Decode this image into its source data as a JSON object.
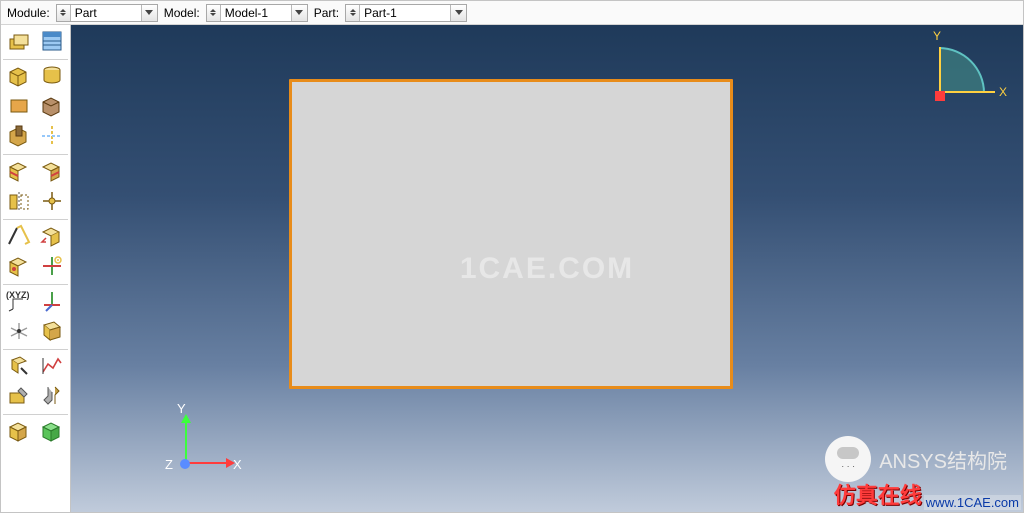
{
  "context": {
    "module_label": "Module:",
    "module_value": "Part",
    "model_label": "Model:",
    "model_value": "Model-1",
    "part_label": "Part:",
    "part_value": "Part-1"
  },
  "toolbox": {
    "row0": [
      "create-part",
      "part-manager"
    ],
    "row1": [
      "create-solid-extrude",
      "create-solid-revolve"
    ],
    "row2": [
      "create-shell",
      "create-wire"
    ],
    "row3": [
      "create-cut",
      "create-round"
    ],
    "row4": [
      "partition-cell",
      "partition-face"
    ],
    "row5": [
      "mirror",
      "datum-tool"
    ],
    "row6": [
      "remove-face",
      "offset-face"
    ],
    "row7": [
      "datum-point",
      "repair"
    ],
    "row8": [
      "datum-csys",
      "datum-axis"
    ],
    "row9": [
      "datum-plane",
      "reference-point"
    ],
    "row10": [
      "query",
      "plot"
    ],
    "row11": [
      "geometry-edit",
      "toolbox-customize"
    ],
    "row12": [
      "rebuild",
      "stitch"
    ]
  },
  "viewport": {
    "watermark": "1CAE.COM",
    "axes": {
      "x": "X",
      "y": "Y",
      "z": "Z"
    },
    "sketch_axes": {
      "x": "X",
      "y": "Y"
    }
  },
  "branding": {
    "channel": "ANSYS结构院",
    "site_cn": "仿真在线",
    "site_url": "www.1CAE.com"
  }
}
